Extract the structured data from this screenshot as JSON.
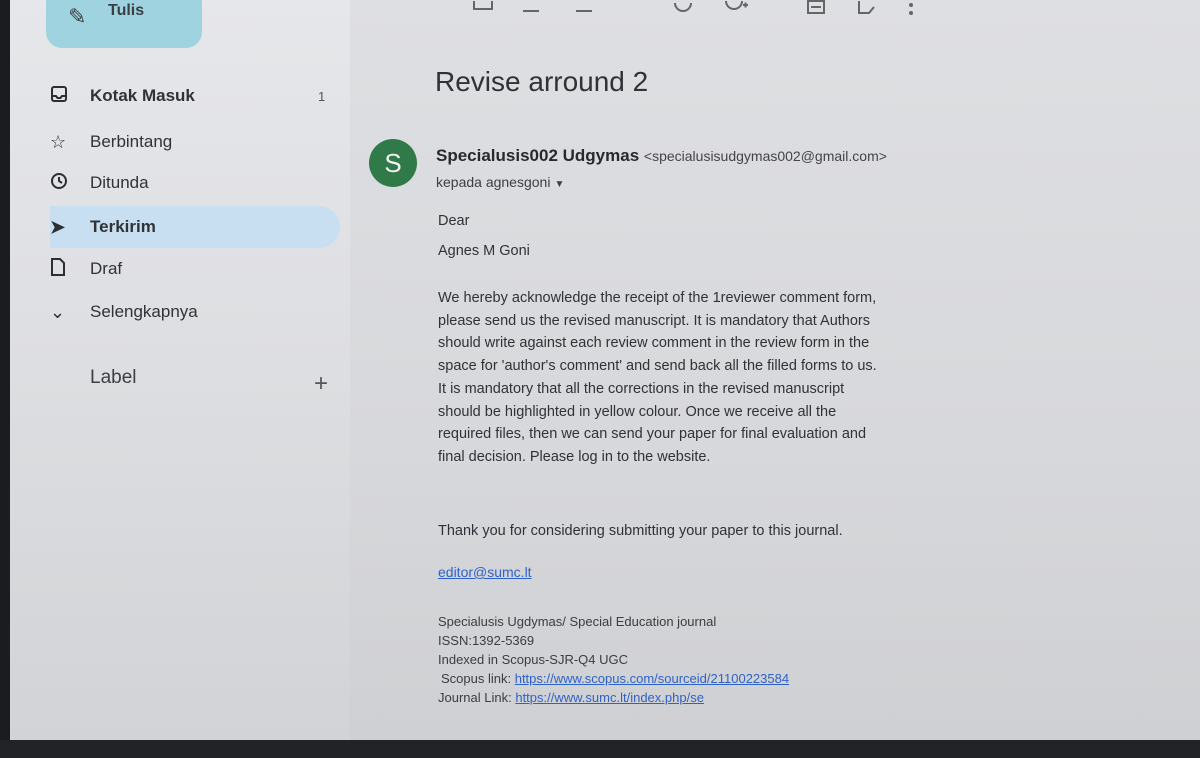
{
  "compose": {
    "label": "Tulis"
  },
  "sidebar": {
    "items": [
      {
        "label": "Kotak Masuk",
        "count": "1"
      },
      {
        "label": "Berbintang"
      },
      {
        "label": "Ditunda"
      },
      {
        "label": "Terkirim"
      },
      {
        "label": "Draf"
      },
      {
        "label": "Selengkapnya"
      }
    ],
    "labels_header": "Label"
  },
  "email": {
    "subject": "Revise arround 2",
    "avatar_letter": "S",
    "sender_name": "Specialusis002 Udgymas",
    "sender_email": "<specialusisudgymas002@gmail.com>",
    "to_line": "kepada agnesgoni",
    "greeting_1": "Dear",
    "greeting_2": "Agnes M Goni",
    "body_lines": [
      "We hereby acknowledge the receipt of the 1reviewer comment form,",
      "please send us the revised manuscript. It is mandatory that Authors",
      "should write against each review comment in the review form in the",
      "space for 'author's comment' and send back all the filled forms to us.",
      "It is mandatory that all the corrections in the revised manuscript",
      "should be highlighted in yellow colour. Once we receive all the",
      "required files, then we can send your paper for final evaluation and",
      "final decision. Please log in to the website."
    ],
    "thanks": "Thank you for considering submitting your paper to this journal.",
    "contact_email": "editor@sumc.lt",
    "signature": {
      "journal": "Specialusis Ugdymas/ Special Education journal",
      "issn": "ISSN:1392-5369",
      "indexed": "Indexed in Scopus-SJR-Q4 UGC",
      "scopus_label": "Scopus link:",
      "scopus_url": "https://www.scopus.com/sourceid/21100223584",
      "journal_label": "Journal Link:",
      "journal_url": "https://www.sumc.lt/index.php/se"
    }
  },
  "icons": [
    "pencil-icon",
    "inbox-icon",
    "star-icon",
    "clock-icon",
    "send-icon",
    "file-icon",
    "chevron-down-icon",
    "plus-icon",
    "archive-icon",
    "report-icon",
    "delete-icon",
    "mark-unread-icon",
    "snooze-icon",
    "add-task-icon",
    "move-to-icon",
    "label-icon",
    "more-vert-icon"
  ]
}
